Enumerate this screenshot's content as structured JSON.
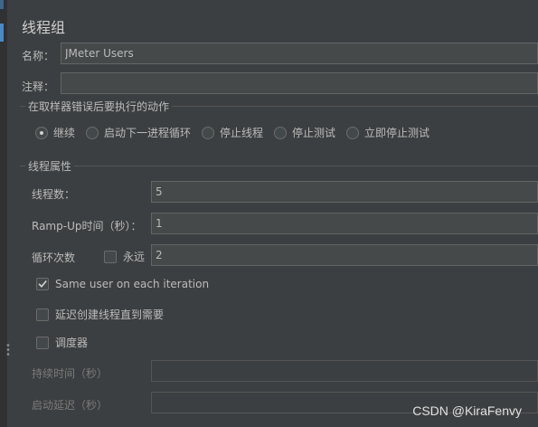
{
  "panel": {
    "title": "线程组",
    "name_label": "名称：",
    "name_value": "JMeter Users",
    "comment_label": "注释：",
    "comment_value": ""
  },
  "error_action": {
    "title": "在取样器错误后要执行的动作",
    "options": [
      {
        "label": "继续",
        "selected": true
      },
      {
        "label": "启动下一进程循环",
        "selected": false
      },
      {
        "label": "停止线程",
        "selected": false
      },
      {
        "label": "停止测试",
        "selected": false
      },
      {
        "label": "立即停止测试",
        "selected": false
      }
    ]
  },
  "thread_props": {
    "title": "线程属性",
    "threads_label": "线程数：",
    "threads_value": "5",
    "rampup_label": "Ramp-Up时间（秒）：",
    "rampup_value": "1",
    "loop_label": "循环次数",
    "forever_label": "永远",
    "forever_checked": false,
    "loop_value": "2",
    "same_user_label": "Same user on each iteration",
    "same_user_checked": true,
    "delay_create_label": "延迟创建线程直到需要",
    "delay_create_checked": false,
    "scheduler_label": "调度器",
    "scheduler_checked": false,
    "duration_label": "持续时间（秒）",
    "duration_value": "",
    "startup_delay_label": "启动延迟（秒）",
    "startup_delay_value": ""
  },
  "watermark": "CSDN @KiraFenvy",
  "colors": {
    "background": "#3c3f41",
    "field_background": "#45494a",
    "accent": "#4a88c7"
  }
}
